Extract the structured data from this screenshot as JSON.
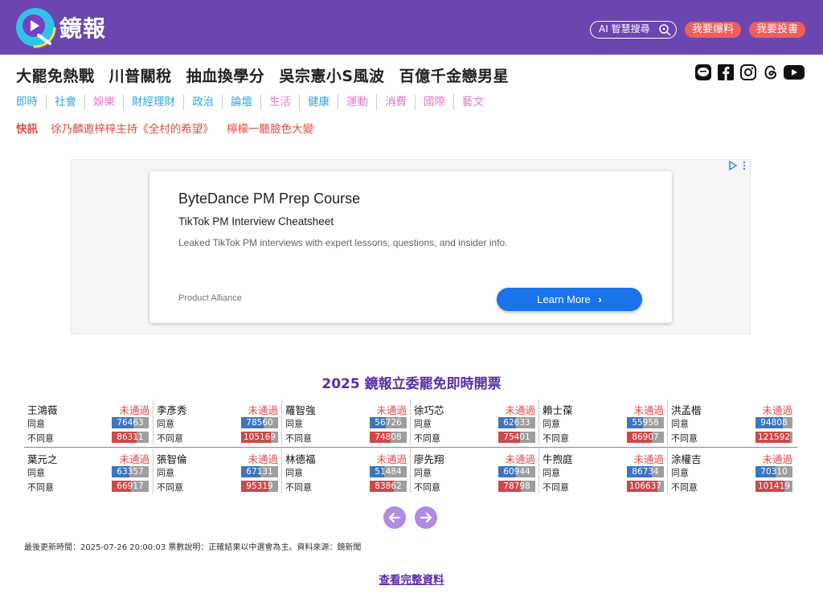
{
  "header": {
    "logo_text": "鏡報",
    "ai_search_label": "AI 智慧搜尋",
    "report_label": "我要爆料",
    "submit_label": "我要投書"
  },
  "hot_topics": [
    "大罷免熱戰",
    "川普關稅",
    "抽血換學分",
    "吳宗憲小S風波",
    "百億千金戀男星"
  ],
  "social": [
    "line-icon",
    "facebook-icon",
    "instagram-icon",
    "threads-icon",
    "youtube-icon"
  ],
  "nav": [
    {
      "label": "即時",
      "color": "#2aa7d8"
    },
    {
      "label": "社會",
      "color": "#2aa7d8"
    },
    {
      "label": "娛樂",
      "color": "#e07ad0"
    },
    {
      "label": "財經理財",
      "color": "#2aa7d8"
    },
    {
      "label": "政治",
      "color": "#2aa7d8"
    },
    {
      "label": "論壇",
      "color": "#2aa7d8"
    },
    {
      "label": "生活",
      "color": "#e07ad0"
    },
    {
      "label": "健康",
      "color": "#2aa7d8"
    },
    {
      "label": "運動",
      "color": "#e07ad0"
    },
    {
      "label": "消費",
      "color": "#e07ad0"
    },
    {
      "label": "國際",
      "color": "#e07ad0"
    },
    {
      "label": "藝文",
      "color": "#e07ad0"
    }
  ],
  "flash": {
    "label": "快訊",
    "items": [
      "徐乃麟邀梓梓主持《全村的希望》",
      "檸檬一聽臉色大變"
    ]
  },
  "ad": {
    "title": "ByteDance PM Prep Course",
    "subtitle": "TikTok PM Interview Cheatsheet",
    "description": "Leaked TikTok PM interviews with expert lessons, questions, and insider info.",
    "brand": "Product Alliance",
    "cta": "Learn More"
  },
  "recall": {
    "title": "2025 鏡報立委罷免即時開票",
    "agree_label": "同意",
    "disagree_label": "不同意",
    "max_votes": 130000,
    "candidates": [
      {
        "name": "王鴻薇",
        "status": "未通過",
        "agree": "76463",
        "disagree": "86311"
      },
      {
        "name": "李彥秀",
        "status": "未通過",
        "agree": "78560",
        "disagree": "105169"
      },
      {
        "name": "羅智強",
        "status": "未通過",
        "agree": "56726",
        "disagree": "74808"
      },
      {
        "name": "徐巧芯",
        "status": "未通過",
        "agree": "62633",
        "disagree": "75401"
      },
      {
        "name": "賴士葆",
        "status": "未通過",
        "agree": "55958",
        "disagree": "86907"
      },
      {
        "name": "洪孟楷",
        "status": "未通過",
        "agree": "94808",
        "disagree": "121592"
      },
      {
        "name": "葉元之",
        "status": "未通過",
        "agree": "63357",
        "disagree": "66917"
      },
      {
        "name": "張智倫",
        "status": "未通過",
        "agree": "67131",
        "disagree": "95319"
      },
      {
        "name": "林德福",
        "status": "未通過",
        "agree": "51484",
        "disagree": "83862"
      },
      {
        "name": "廖先翔",
        "status": "未通過",
        "agree": "60944",
        "disagree": "78798"
      },
      {
        "name": "牛煦庭",
        "status": "未通過",
        "agree": "86734",
        "disagree": "106637"
      },
      {
        "name": "涂權吉",
        "status": "未通過",
        "agree": "70310",
        "disagree": "101419"
      }
    ],
    "updated": "最後更新時間：2025-07-26 20:00:03 票數說明：正確結果以中選會為主。資料來源：鏡新聞",
    "more_label": "查看完整資料"
  }
}
